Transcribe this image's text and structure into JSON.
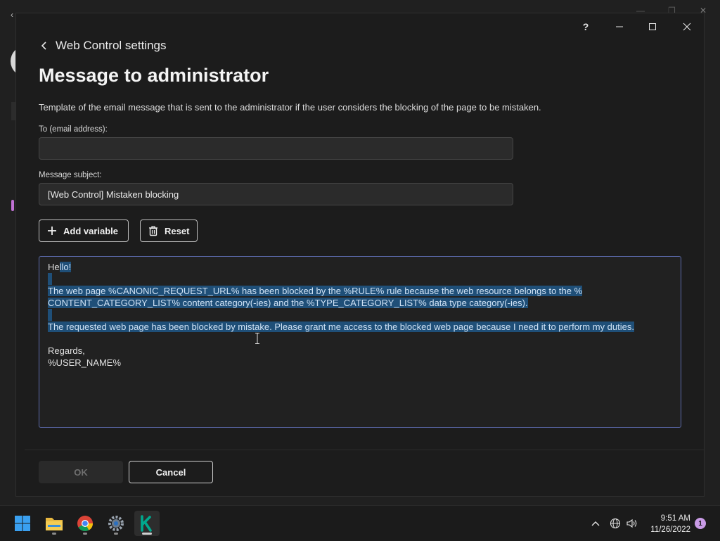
{
  "dialog": {
    "breadcrumb": "Web Control settings",
    "title": "Message to administrator",
    "description": "Template of the email message that is sent to the administrator if the user considers the blocking of the page to be mistaken.",
    "to_label": "To (email address):",
    "to_value": "",
    "subject_label": "Message subject:",
    "subject_value": "[Web Control] Mistaken blocking",
    "add_variable_label": "Add variable",
    "reset_label": "Reset",
    "message": {
      "greeting_prefix": "He",
      "greeting_selected": "llo!",
      "paragraph1_line1": "The web page %CANONIC_REQUEST_URL% has been blocked by the %RULE% rule because the web resource belongs to the %",
      "paragraph1_line2": "CONTENT_CATEGORY_LIST% content category(-ies) and the %TYPE_CATEGORY_LIST% data type category(-ies).",
      "paragraph2": "The requested web page has been blocked by mistake. Please grant me access to the blocked web page because I need it to perform my duties.",
      "regards": "Regards,",
      "signature": "%USER_NAME%"
    },
    "ok_label": "OK",
    "cancel_label": "Cancel",
    "title_controls": {
      "help": "?"
    }
  },
  "taskbar": {
    "apps": [
      "start-icon",
      "file-explorer-icon",
      "chrome-icon",
      "settings-icon",
      "kaspersky-icon"
    ],
    "clock_time": "9:51 AM",
    "clock_date": "11/26/2022",
    "notification_count": "1"
  },
  "colors": {
    "selection": "#1f4f78",
    "focus_border": "#5a68a8",
    "kaspersky_green": "#00a88e"
  }
}
